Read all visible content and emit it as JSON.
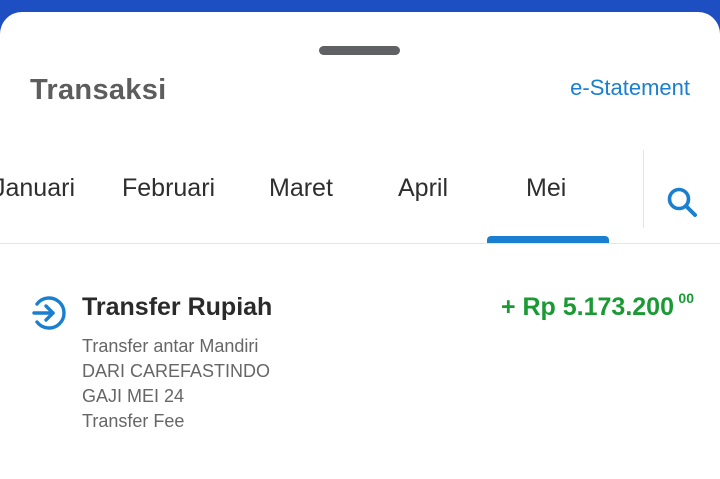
{
  "header": {
    "title": "Transaksi",
    "estatement_label": "e-Statement"
  },
  "months": {
    "items": [
      "Januari",
      "Februari",
      "Maret",
      "April",
      "Mei"
    ],
    "selected": "Mei"
  },
  "search": {
    "icon": "search-icon"
  },
  "transaction": {
    "icon": "arrow-circle-in-icon",
    "title": "Transfer Rupiah",
    "amount": "+ Rp 5.173.200",
    "amount_cents": "00",
    "details": [
      "Transfer antar Mandiri",
      "DARI CAREFASTINDO",
      "GAJI MEI 24",
      "Transfer Fee"
    ]
  },
  "colors": {
    "accent": "#1a7fd0",
    "credit": "#1a9a33",
    "topbar": "#1e4fc2"
  }
}
